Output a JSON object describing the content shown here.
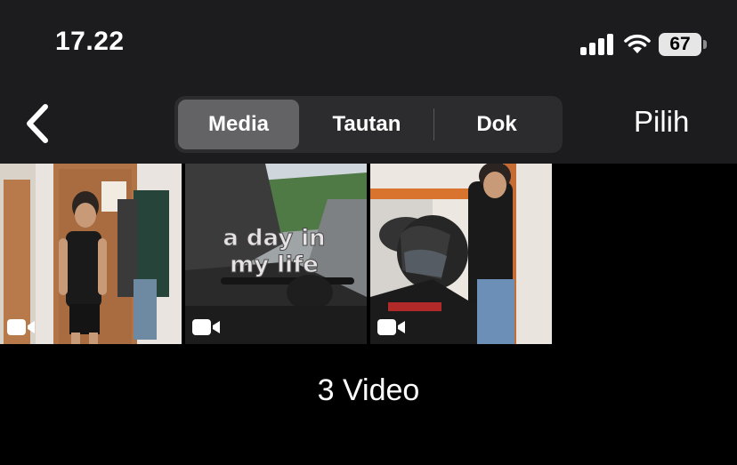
{
  "status_bar": {
    "time": "17.22",
    "battery_level": "67"
  },
  "nav": {
    "segments": [
      {
        "label": "Media",
        "selected": true
      },
      {
        "label": "Tautan",
        "selected": false
      },
      {
        "label": "Dok",
        "selected": false
      }
    ],
    "select_label": "Pilih"
  },
  "media": {
    "items": [
      {
        "type": "video",
        "icon": "video-camera-icon"
      },
      {
        "type": "video",
        "icon": "video-camera-icon",
        "overlay_text_line1": "a day in",
        "overlay_text_line2": "my life"
      },
      {
        "type": "video",
        "icon": "video-camera-icon"
      }
    ],
    "count_label": "3 Video"
  },
  "colors": {
    "background": "#000000",
    "header": "#1c1c1e",
    "segment_bg": "#2c2c2e",
    "segment_selected": "#636366"
  }
}
